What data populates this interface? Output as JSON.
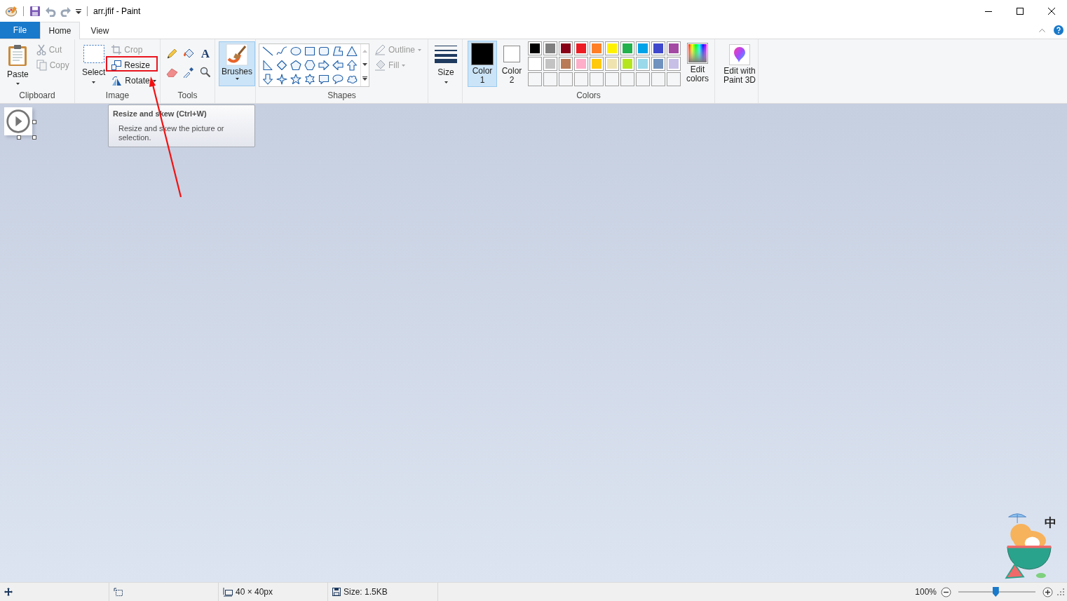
{
  "window": {
    "title": "arr.jfif - Paint"
  },
  "tabs": [
    {
      "label": "File",
      "kind": "file",
      "selected": false
    },
    {
      "label": "Home",
      "kind": "tab",
      "selected": true
    },
    {
      "label": "View",
      "kind": "tab",
      "selected": false
    }
  ],
  "clipboard": {
    "label": "Clipboard",
    "paste": "Paste",
    "cut": {
      "label": "Cut",
      "disabled": true
    },
    "copy": {
      "label": "Copy",
      "disabled": true
    }
  },
  "image": {
    "label": "Image",
    "select": "Select",
    "crop": {
      "label": "Crop",
      "disabled": true
    },
    "resize": {
      "label": "Resize",
      "disabled": false
    },
    "rotate": {
      "label": "Rotate",
      "disabled": false
    }
  },
  "tools": {
    "label": "Tools",
    "text_glyph": "A"
  },
  "brushes": {
    "label": "Brushes",
    "selected": true
  },
  "shapes": {
    "label": "Shapes",
    "outline": {
      "label": "Outline",
      "disabled": true
    },
    "fill": {
      "label": "Fill",
      "disabled": true
    }
  },
  "size": {
    "label": "Size"
  },
  "colors": {
    "label": "Colors",
    "color1": {
      "label": "Color 1",
      "color": "#000000",
      "selected": true
    },
    "color2": {
      "label": "Color 2",
      "color": "#ffffff",
      "selected": false
    },
    "palette": [
      {
        "color": "#000000"
      },
      {
        "color": "#7f7f7f"
      },
      {
        "color": "#880015"
      },
      {
        "color": "#ed1c24"
      },
      {
        "color": "#ff7f27"
      },
      {
        "color": "#fff200"
      },
      {
        "color": "#22b14c"
      },
      {
        "color": "#00a2e8"
      },
      {
        "color": "#3f48cc"
      },
      {
        "color": "#a349a4"
      },
      {
        "color": "#ffffff"
      },
      {
        "color": "#c3c3c3"
      },
      {
        "color": "#b97a57"
      },
      {
        "color": "#ffaec9"
      },
      {
        "color": "#ffc90e"
      },
      {
        "color": "#efe4b0"
      },
      {
        "color": "#b5e61d"
      },
      {
        "color": "#99d9ea"
      },
      {
        "color": "#7092be"
      },
      {
        "color": "#c8bfe7"
      },
      {
        "kind": "empty"
      },
      {
        "kind": "empty"
      },
      {
        "kind": "empty"
      },
      {
        "kind": "empty"
      },
      {
        "kind": "empty"
      },
      {
        "kind": "empty"
      },
      {
        "kind": "empty"
      },
      {
        "kind": "empty"
      },
      {
        "kind": "empty"
      },
      {
        "kind": "empty"
      }
    ],
    "edit_colors": "Edit colors"
  },
  "paint3d": {
    "label": "Edit with Paint 3D"
  },
  "tooltip": {
    "title": "Resize and skew (Ctrl+W)",
    "description": "Resize and skew the picture or selection."
  },
  "status_bar": {
    "dimensions": "40 × 40px",
    "file_size": "Size: 1.5KB",
    "zoom": "100%",
    "zoom_slider": {
      "level": 0.48
    }
  },
  "ime": {
    "mode": "中"
  }
}
